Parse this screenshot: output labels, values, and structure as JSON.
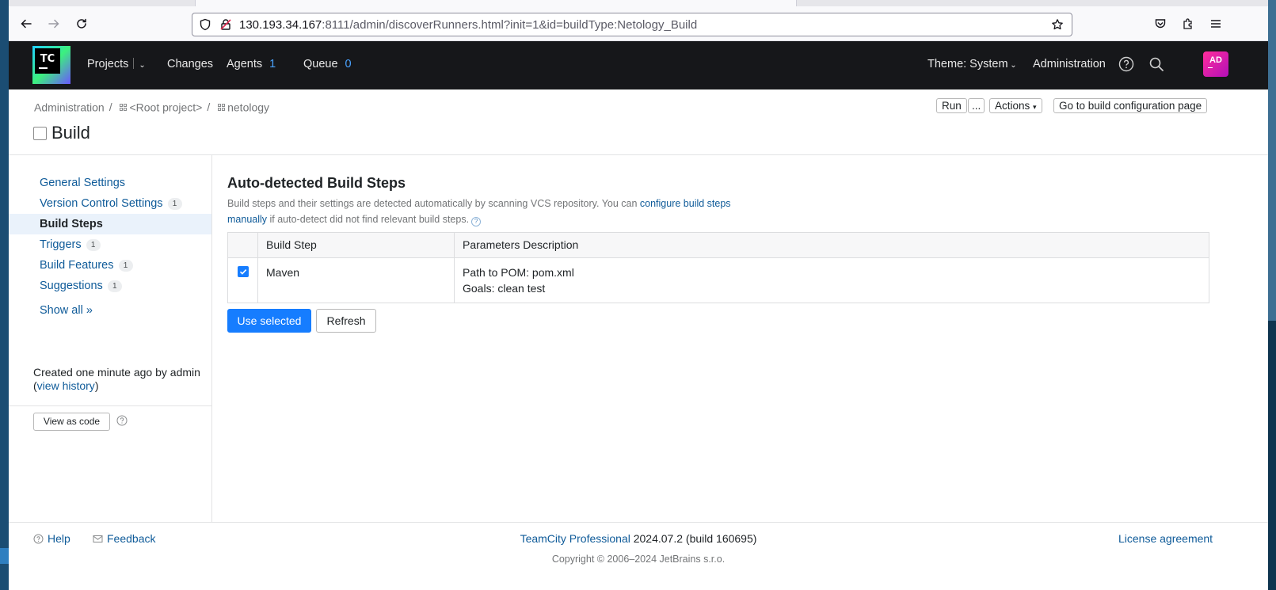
{
  "browser": {
    "url_host": "130.193.34.167",
    "url_rest": ":8111/admin/discoverRunners.html?init=1&id=buildType:Netology_Build"
  },
  "header": {
    "logo_text": "TC",
    "projects": "Projects",
    "changes": "Changes",
    "agents": "Agents",
    "agents_count": "1",
    "queue": "Queue",
    "queue_count": "0",
    "theme": "Theme: System",
    "administration": "Administration",
    "avatar_initials": "AD"
  },
  "breadcrumb": {
    "items": [
      "Administration",
      "<Root project>",
      "netology"
    ],
    "separator": "/"
  },
  "page": {
    "title": "Build",
    "run_label": "Run",
    "run_more_label": "...",
    "actions_label": "Actions",
    "goto_label": "Go to build configuration page"
  },
  "sidebar": {
    "items": [
      {
        "label": "General Settings",
        "count": ""
      },
      {
        "label": "Version Control Settings",
        "count": "1"
      },
      {
        "label": "Build Steps",
        "count": ""
      },
      {
        "label": "Triggers",
        "count": "1"
      },
      {
        "label": "Build Features",
        "count": "1"
      },
      {
        "label": "Suggestions",
        "count": "1"
      }
    ],
    "show_all": "Show all »",
    "created_text": "Created one minute ago by admin (",
    "view_history": "view history",
    "created_close": ")",
    "view_as_code": "View as code"
  },
  "main": {
    "title": "Auto-detected Build Steps",
    "desc_prefix": "Build steps and their settings are detected automatically by scanning VCS repository. You can ",
    "desc_link": "configure build steps manually",
    "desc_suffix": " if auto-detect did not find relevant build steps.",
    "table": {
      "headers": [
        "Build Step",
        "Parameters Description"
      ],
      "rows": [
        {
          "step": "Maven",
          "params": [
            "Path to POM: pom.xml",
            "Goals: clean test"
          ],
          "checked": true
        }
      ]
    },
    "use_selected": "Use selected",
    "refresh": "Refresh"
  },
  "footer": {
    "help": "Help",
    "feedback": "Feedback",
    "brand": "TeamCity Professional",
    "version": "2024.07.2 (build 160695)",
    "license": "License agreement",
    "copyright": "Copyright © 2006–2024 JetBrains s.r.o."
  },
  "colors": {
    "accent": "#167dff",
    "link": "#0f5b99",
    "header_bg": "#16171a"
  }
}
